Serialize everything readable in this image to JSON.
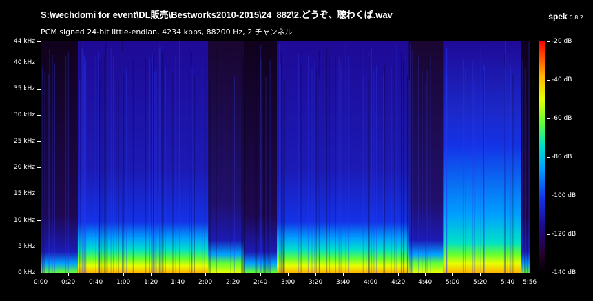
{
  "header": {
    "title": "S:\\wechdomi for event\\DL販売\\Bestworks2010-2015\\24_882\\2.どうぞ、聴わくぱ.wav",
    "subtitle": "PCM signed 24-bit little-endian, 4234 kbps, 88200 Hz, 2 チャンネル"
  },
  "app": {
    "name": "spek",
    "version": "0.8.2"
  },
  "colors": {
    "background": "#000000",
    "text": "#ffffff"
  },
  "chart_data": {
    "type": "heatmap",
    "xlabel": "",
    "ylabel": "",
    "xlim_seconds": [
      0,
      356
    ],
    "ylim_khz": [
      0,
      44
    ],
    "color_range_db": [
      -140,
      -20
    ],
    "y_ticks": [
      "0 kHz",
      "5 kHz",
      "10 kHz",
      "15 kHz",
      "20 kHz",
      "25 kHz",
      "30 kHz",
      "35 kHz",
      "40 kHz",
      "44 kHz"
    ],
    "x_ticks": [
      "0:00",
      "0:20",
      "0:40",
      "1:00",
      "1:20",
      "1:40",
      "2:00",
      "2:20",
      "2:40",
      "3:00",
      "3:20",
      "3:40",
      "4:00",
      "4:20",
      "4:40",
      "5:00",
      "5:20",
      "5:40",
      "5:56"
    ],
    "db_ticks": [
      "-20 dB",
      "-40 dB",
      "-60 dB",
      "-80 dB",
      "-100 dB",
      "-120 dB",
      "-140 dB"
    ],
    "colormap": [
      "#28002d",
      "#1c0a8c",
      "#1432e6",
      "#00a0ff",
      "#00e1c8",
      "#64ff32",
      "#e6ff00",
      "#ffb400",
      "#ff5000",
      "#ff0000"
    ],
    "segments": [
      {
        "start": 0,
        "end": 27,
        "level": "low"
      },
      {
        "start": 27,
        "end": 122,
        "level": "high"
      },
      {
        "start": 122,
        "end": 148,
        "level": "mid"
      },
      {
        "start": 148,
        "end": 172,
        "level": "low"
      },
      {
        "start": 172,
        "end": 268,
        "level": "high"
      },
      {
        "start": 268,
        "end": 293,
        "level": "mid"
      },
      {
        "start": 293,
        "end": 350,
        "level": "peak"
      },
      {
        "start": 350,
        "end": 356,
        "level": "low"
      }
    ]
  }
}
